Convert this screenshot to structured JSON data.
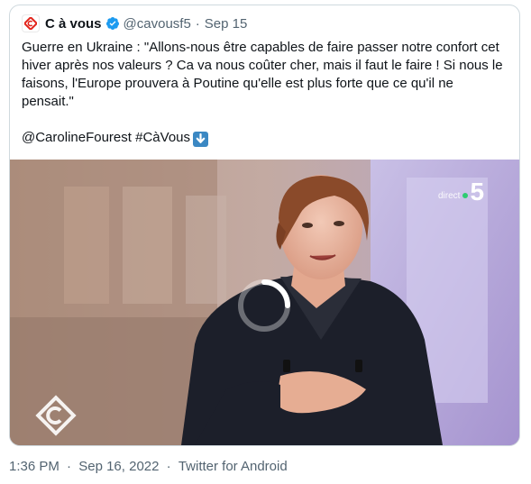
{
  "tweet": {
    "account_name": "C à vous",
    "handle": "@cavousf5",
    "separator": "·",
    "date_short": "Sep 15",
    "text_line1": "Guerre en Ukraine : \"Allons-nous être capables de faire passer notre confort cet hiver après nos valeurs ? Ca va nous coûter cher, mais il faut le faire ! Si nous le faisons, l'Europe prouvera à Poutine qu'elle est plus forte que ce qu'il ne pensait.\"",
    "mention": "@CarolineFourest",
    "hashtag": "#CàVous",
    "icons": {
      "avatar": "c-a-vous-logo-icon",
      "verified": "verified-badge-icon",
      "emoji": "down-arrow-emoji-icon"
    }
  },
  "media": {
    "channel_label": "direct",
    "channel_number": "5",
    "icons": {
      "loading": "loading-spinner-icon",
      "watermark": "c-a-vous-watermark-icon"
    }
  },
  "footer": {
    "time": "1:36 PM",
    "separator1": "·",
    "date": "Sep 16, 2022",
    "separator2": "·",
    "source": "Twitter for Android"
  },
  "colors": {
    "verified": "#1d9bf0",
    "brand_red": "#e2231a",
    "muted": "#536471",
    "border": "#cfd9de",
    "emoji_blue": "#3b88c3"
  }
}
